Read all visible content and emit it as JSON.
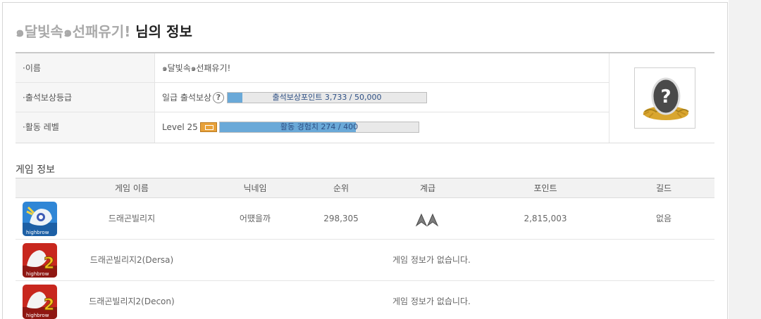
{
  "page_title": {
    "nickname": "๑달빛속๑선패유기!",
    "suffix": " 님의 정보"
  },
  "profile": {
    "name_label": "·이름",
    "name_value": "๑달빛속๑선패유기!",
    "attendance_label": "·출석보상등급",
    "attendance_value": "일급 출석보상",
    "attendance_bar_text": "출석보상포인트 3,733 / 50,000",
    "attendance_progress": 0.07466,
    "level_label": "·활동 레벨",
    "level_value": "Level 25",
    "level_bar_text": "활동 경험치 274 / 400",
    "level_progress": 0.685,
    "help_icon": "question-circle-icon",
    "avatar_icon": "egg-in-nest-icon"
  },
  "games_section": {
    "title": "게임 정보",
    "headers": {
      "name": "게임 이름",
      "nickname": "닉네임",
      "rank": "순위",
      "grade": "계급",
      "point": "포인트",
      "guild": "길드"
    },
    "rows": [
      {
        "icon": "dragon-village-icon",
        "name": "드래곤빌리지",
        "nickname": "어떘을까",
        "rank": "298,305",
        "grade": "double-chevron-rank-icon",
        "point": "2,815,003",
        "guild": "없음"
      },
      {
        "icon": "dragon-village-2-icon",
        "name": "드래곤빌리지2(Dersa)",
        "message": "게임 정보가 없습니다."
      },
      {
        "icon": "dragon-village-2-icon",
        "name": "드래곤빌리지2(Decon)",
        "message": "게임 정보가 없습니다."
      }
    ]
  },
  "colors": {
    "progress_fill": "#6aa9d8",
    "progress_bg": "#e9e9e9",
    "level_icon": "#e8a13a",
    "nickname_gray": "#a9a9a9"
  }
}
